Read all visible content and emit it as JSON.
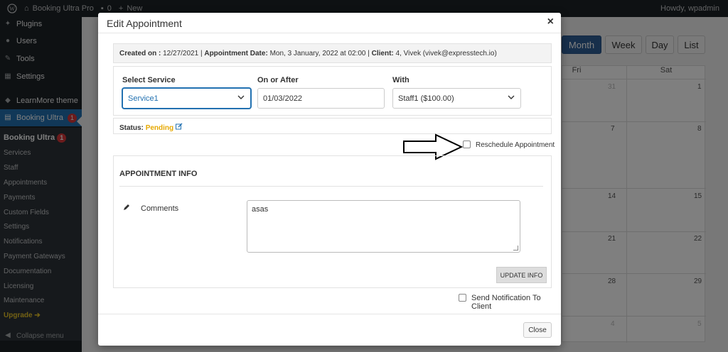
{
  "admin_bar": {
    "site_name": "Booking Ultra Pro",
    "comments_count": "0",
    "new_label": "New",
    "howdy": "Howdy, wpadmin"
  },
  "sidebar": {
    "items": [
      {
        "label": "Plugins",
        "icon": "plug-icon"
      },
      {
        "label": "Users",
        "icon": "users-icon"
      },
      {
        "label": "Tools",
        "icon": "wrench-icon"
      },
      {
        "label": "Settings",
        "icon": "settings-icon"
      },
      {
        "label": "LearnMore theme",
        "icon": "theme-icon"
      },
      {
        "label": "Booking Ultra",
        "icon": "calendar-icon",
        "badge": "1"
      }
    ],
    "submenu_head": "Booking Ultra",
    "submenu_badge": "1",
    "submenu": [
      "Services",
      "Staff",
      "Appointments",
      "Payments",
      "Custom Fields",
      "Settings",
      "Notifications",
      "Payment Gateways",
      "Documentation",
      "Licensing",
      "Maintenance"
    ],
    "upgrade": "Upgrade ➔",
    "collapse": "Collapse menu"
  },
  "calendar": {
    "views": [
      "Month",
      "Week",
      "Day",
      "List"
    ],
    "active_view": "Month",
    "days": [
      "Fri",
      "Sat"
    ],
    "rows": [
      [
        "31",
        "1"
      ],
      [
        "7",
        "8"
      ],
      [
        "14",
        "15"
      ],
      [
        "21",
        "22"
      ],
      [
        "28",
        "29"
      ],
      [
        "4",
        "5"
      ]
    ]
  },
  "modal": {
    "title": "Edit Appointment",
    "close_icon": "×",
    "created_on_label": "Created on :",
    "created_on_value": "12/27/2021",
    "appt_date_label": "Appointment Date:",
    "appt_date_value": "Mon, 3 January, 2022 at 02:00",
    "client_label": "Client:",
    "client_value": "4, Vivek (vivek@expresstech.io)",
    "select_service_label": "Select Service",
    "select_service_value": "Service1",
    "on_or_after_label": "On or After",
    "on_or_after_value": "01/03/2022",
    "with_label": "With",
    "with_value": "Staff1 ($100.00)",
    "status_label": "Status:",
    "status_value": "Pending",
    "reschedule_label": "Reschedule Appointment",
    "info_title": "APPOINTMENT INFO",
    "comments_label": "Comments",
    "comments_value": "asas",
    "update_button": "UPDATE INFO",
    "notify_label": "Send Notification To Client",
    "close_button": "Close"
  },
  "colors": {
    "accent": "#2271b1",
    "pending": "#e6a800",
    "admin_bg": "#1d2327"
  }
}
